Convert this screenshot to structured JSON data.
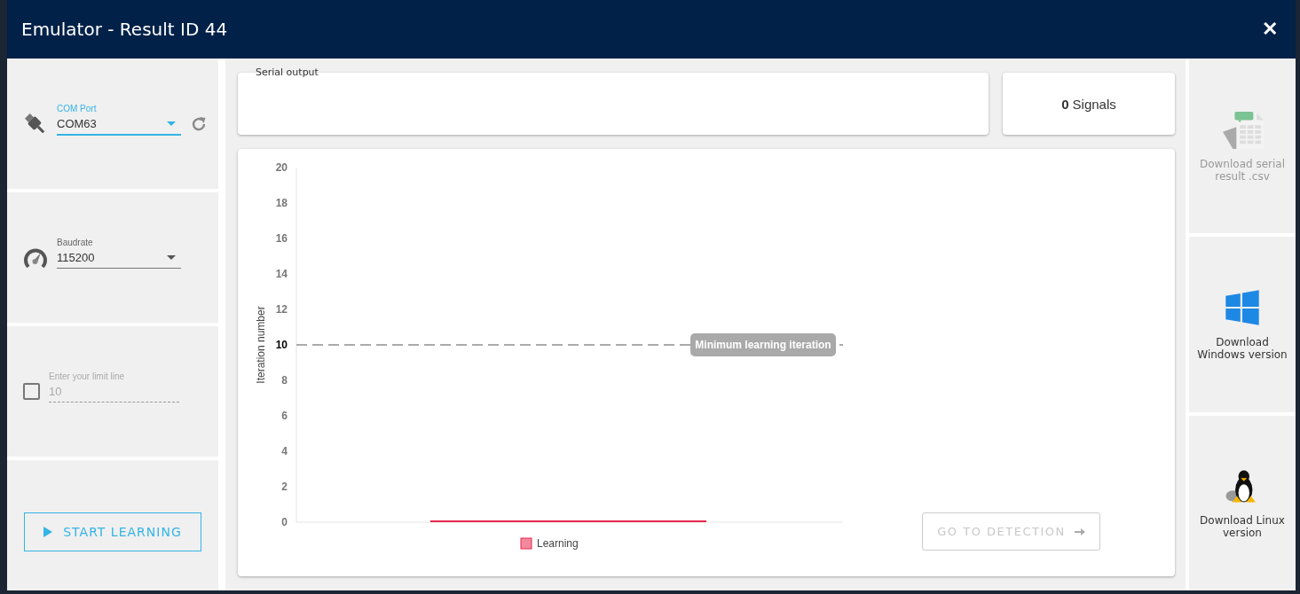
{
  "window": {
    "title": "Emulator - Result ID 44",
    "close": "✕"
  },
  "settings": [
    {
      "kind": "port",
      "label": "COM Port",
      "value": "COM63",
      "focused": true
    },
    {
      "kind": "baudrate",
      "label": "Baudrate",
      "value": "115200",
      "focused": false
    },
    {
      "kind": "limit",
      "label": "Enter your limit line",
      "value": "10",
      "checked": false,
      "disabled": true
    }
  ],
  "start_button": {
    "label": "START LEARNING"
  },
  "serial_output": {
    "label": "Serial output"
  },
  "signals": {
    "count": "0",
    "label": "Signals"
  },
  "chart": {
    "chart_data": {
      "type": "bar",
      "ylabel": "Iteration number",
      "ylim": [
        0,
        20
      ],
      "yticks": [
        0,
        2,
        4,
        6,
        8,
        10,
        12,
        14,
        16,
        18,
        20
      ],
      "series": [
        {
          "name": "Learning",
          "color": "#e8284e",
          "values": [
            0
          ]
        }
      ],
      "ref_lines": [
        {
          "axis": "y",
          "value": 10,
          "label": "Minimum learning iteration"
        }
      ]
    },
    "detection_button": {
      "label": "GO TO DETECTION",
      "disabled": true
    }
  },
  "downloads": [
    {
      "kind": "csv",
      "label": "Download serial result .csv",
      "disabled": true
    },
    {
      "kind": "windows",
      "label": "Download Windows version",
      "disabled": false
    },
    {
      "kind": "linux",
      "label": "Download Linux version",
      "disabled": false
    }
  ]
}
